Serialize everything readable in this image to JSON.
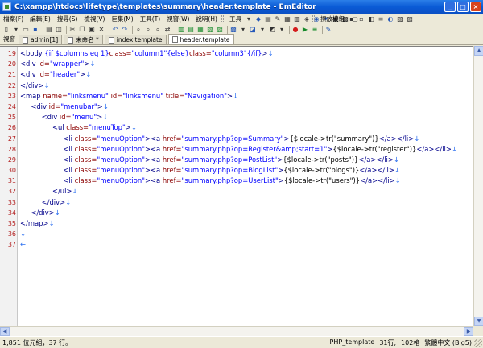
{
  "window": {
    "title": "C:\\xampp\\htdocs\\lifetype\\templates\\summary\\header.template - EmEditor",
    "minimize": "_",
    "maximize": "□",
    "close": "×"
  },
  "menu": {
    "items": [
      "檔案(F)",
      "編輯(E)",
      "搜尋(S)",
      "檢視(V)",
      "巨集(M)",
      "工具(T)",
      "視窗(W)",
      "說明(H)"
    ],
    "tools_label": "工具",
    "plugins_label": "擦放模組"
  },
  "tabs": {
    "label": "視窗",
    "items": [
      {
        "label": "admin[1]",
        "active": false
      },
      {
        "label": "未命名 *",
        "active": false
      },
      {
        "label": "index.template",
        "active": false
      },
      {
        "label": "header.template",
        "active": true
      }
    ]
  },
  "editor": {
    "lines": [
      {
        "n": "19",
        "segs": [
          [
            "tg",
            "<body "
          ],
          [
            "va",
            "{if $columns eq 1}"
          ],
          [
            "at",
            "class="
          ],
          [
            "va",
            "\"column1\""
          ],
          [
            "va",
            "{else}"
          ],
          [
            "at",
            "class="
          ],
          [
            "va",
            "\"column3\""
          ],
          [
            "va",
            "{/if}"
          ],
          [
            "tg",
            ">"
          ],
          [
            "eol",
            "↓"
          ]
        ]
      },
      {
        "n": "20",
        "segs": [
          [
            "tg",
            "<div "
          ],
          [
            "at",
            "id="
          ],
          [
            "va",
            "\"wrapper\""
          ],
          [
            "tg",
            ">"
          ],
          [
            "eol",
            "↓"
          ]
        ]
      },
      {
        "n": "21",
        "segs": [
          [
            "tg",
            "<div "
          ],
          [
            "at",
            "id="
          ],
          [
            "va",
            "\"header\""
          ],
          [
            "tg",
            ">"
          ],
          [
            "eol",
            "↓"
          ]
        ]
      },
      {
        "n": "22",
        "segs": [
          [
            "tg",
            "</div>"
          ],
          [
            "eol",
            "↓"
          ]
        ]
      },
      {
        "n": "23",
        "segs": [
          [
            "tg",
            "<map "
          ],
          [
            "at",
            "name="
          ],
          [
            "va",
            "\"linksmenu\""
          ],
          [
            "tx",
            " "
          ],
          [
            "at",
            "id="
          ],
          [
            "va",
            "\"linksmenu\""
          ],
          [
            "tx",
            " "
          ],
          [
            "at",
            "title="
          ],
          [
            "va",
            "\"Navigation\""
          ],
          [
            "tg",
            ">"
          ],
          [
            "eol",
            "↓"
          ]
        ]
      },
      {
        "n": "24",
        "segs": [
          [
            "tx",
            "     "
          ],
          [
            "tg",
            "<div "
          ],
          [
            "at",
            "id="
          ],
          [
            "va",
            "\"menubar\""
          ],
          [
            "tg",
            ">"
          ],
          [
            "eol",
            "↓"
          ]
        ]
      },
      {
        "n": "25",
        "segs": [
          [
            "tx",
            "          "
          ],
          [
            "tg",
            "<div "
          ],
          [
            "at",
            "id="
          ],
          [
            "va",
            "\"menu\""
          ],
          [
            "tg",
            ">"
          ],
          [
            "eol",
            "↓"
          ]
        ]
      },
      {
        "n": "26",
        "segs": [
          [
            "tx",
            "               "
          ],
          [
            "tg",
            "<ul "
          ],
          [
            "at",
            "class="
          ],
          [
            "va",
            "\"menuTop\""
          ],
          [
            "tg",
            ">"
          ],
          [
            "eol",
            "↓"
          ]
        ]
      },
      {
        "n": "27",
        "segs": [
          [
            "tx",
            "                    "
          ],
          [
            "tg",
            "<li "
          ],
          [
            "at",
            "class="
          ],
          [
            "va",
            "\"menuOption\""
          ],
          [
            "tg",
            ">"
          ],
          [
            "tg",
            "<a "
          ],
          [
            "at",
            "href="
          ],
          [
            "va",
            "\"summary.php?op=Summary\""
          ],
          [
            "tg",
            ">"
          ],
          [
            "tx",
            "{$locale->tr(\"summary\")}"
          ],
          [
            "tg",
            "</a>"
          ],
          [
            "tg",
            "</li>"
          ],
          [
            "eol",
            "↓"
          ]
        ]
      },
      {
        "n": "28",
        "segs": [
          [
            "tx",
            "                    "
          ],
          [
            "tg",
            "<li "
          ],
          [
            "at",
            "class="
          ],
          [
            "va",
            "\"menuOption\""
          ],
          [
            "tg",
            ">"
          ],
          [
            "tg",
            "<a "
          ],
          [
            "at",
            "href="
          ],
          [
            "va",
            "\"summary.php?op=Register&amp;start=1\""
          ],
          [
            "tg",
            ">"
          ],
          [
            "tx",
            "{$locale->tr(\"register\")}"
          ],
          [
            "tg",
            "</a>"
          ],
          [
            "tg",
            "</li>"
          ],
          [
            "eol",
            "↓"
          ]
        ]
      },
      {
        "n": "29",
        "segs": [
          [
            "tx",
            "                    "
          ],
          [
            "tg",
            "<li "
          ],
          [
            "at",
            "class="
          ],
          [
            "va",
            "\"menuOption\""
          ],
          [
            "tg",
            ">"
          ],
          [
            "tg",
            "<a "
          ],
          [
            "at",
            "href="
          ],
          [
            "va",
            "\"summary.php?op=PostList\""
          ],
          [
            "tg",
            ">"
          ],
          [
            "tx",
            "{$locale->tr(\"posts\")}"
          ],
          [
            "tg",
            "</a>"
          ],
          [
            "tg",
            "</li>"
          ],
          [
            "eol",
            "↓"
          ]
        ]
      },
      {
        "n": "30",
        "segs": [
          [
            "tx",
            "                    "
          ],
          [
            "tg",
            "<li "
          ],
          [
            "at",
            "class="
          ],
          [
            "va",
            "\"menuOption\""
          ],
          [
            "tg",
            ">"
          ],
          [
            "tg",
            "<a "
          ],
          [
            "at",
            "href="
          ],
          [
            "va",
            "\"summary.php?op=BlogList\""
          ],
          [
            "tg",
            ">"
          ],
          [
            "tx",
            "{$locale->tr(\"blogs\")}"
          ],
          [
            "tg",
            "</a>"
          ],
          [
            "tg",
            "</li>"
          ],
          [
            "eol",
            "↓"
          ]
        ]
      },
      {
        "n": "31",
        "segs": [
          [
            "tx",
            "                    "
          ],
          [
            "tg",
            "<li "
          ],
          [
            "at",
            "class="
          ],
          [
            "va",
            "\"menuOption\""
          ],
          [
            "tg",
            ">"
          ],
          [
            "tg",
            "<a "
          ],
          [
            "at",
            "href="
          ],
          [
            "va",
            "\"summary.php?op=UserList\""
          ],
          [
            "tg",
            ">"
          ],
          [
            "tx",
            "{$locale->tr(\"users\")}"
          ],
          [
            "tg",
            "</a>"
          ],
          [
            "tg",
            "</li>"
          ],
          [
            "eol",
            "↓"
          ]
        ]
      },
      {
        "n": "32",
        "segs": [
          [
            "tx",
            "               "
          ],
          [
            "tg",
            "</ul>"
          ],
          [
            "eol",
            "↓"
          ]
        ]
      },
      {
        "n": "33",
        "segs": [
          [
            "tx",
            "          "
          ],
          [
            "tg",
            "</div>"
          ],
          [
            "eol",
            "↓"
          ]
        ]
      },
      {
        "n": "34",
        "segs": [
          [
            "tx",
            "     "
          ],
          [
            "tg",
            "</div>"
          ],
          [
            "eol",
            "↓"
          ]
        ]
      },
      {
        "n": "35",
        "segs": [
          [
            "tg",
            "</map>"
          ],
          [
            "eol",
            "↓"
          ]
        ]
      },
      {
        "n": "36",
        "segs": [
          [
            "eol",
            "↓"
          ]
        ]
      },
      {
        "n": "37",
        "segs": [
          [
            "eol",
            "←"
          ]
        ]
      }
    ]
  },
  "status": {
    "left": "1,851 位元組，37 行。",
    "mode": "PHP_template",
    "position": "31行,",
    "column": "102格",
    "encoding": "繁體中文 (Big5)"
  },
  "colors": {
    "tag": "#00008b",
    "attribute": "#8b0000",
    "value": "#0000ff",
    "line_number": "#b11a1a",
    "eol_mark": "#2b6ff0"
  }
}
